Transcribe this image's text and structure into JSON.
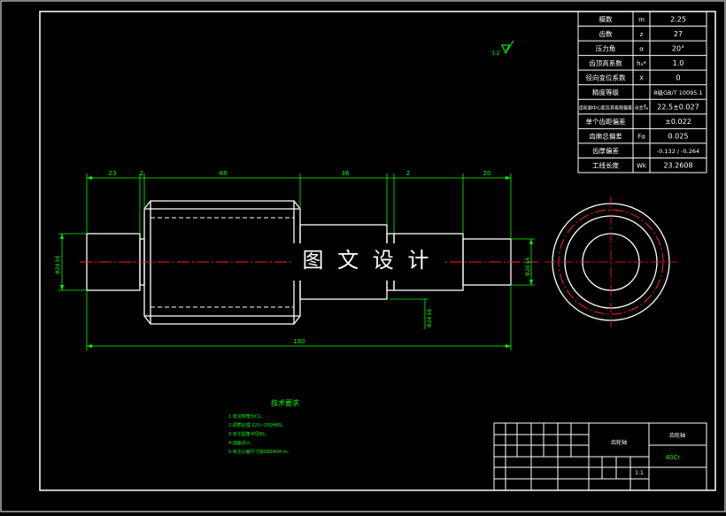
{
  "watermark": "图 文 设 计",
  "roughness": "3.2",
  "gear_table": [
    {
      "name": "模数",
      "symbol": "m",
      "value": "2.25"
    },
    {
      "name": "齿数",
      "symbol": "z",
      "value": "27"
    },
    {
      "name": "压力角",
      "symbol": "α",
      "value": "20°"
    },
    {
      "name": "齿顶高系数",
      "symbol": "hₐ*",
      "value": "1.0"
    },
    {
      "name": "径向变位系数",
      "symbol": "X",
      "value": "0"
    },
    {
      "name": "精度等级",
      "symbol": "",
      "value": "8级GB/T 10095.1"
    },
    {
      "name": "齿轮副中心距及其极限偏差",
      "symbol": "a±fₐ",
      "value": "22.5±0.027"
    },
    {
      "name": "单个齿距偏差",
      "symbol": "",
      "value": "±0.022"
    },
    {
      "name": "齿廓总偏差",
      "symbol": "Fα",
      "value": "0.025"
    },
    {
      "name": "齿厚偏差",
      "symbol": "",
      "value": "-0.132 / -0.264"
    },
    {
      "name": "工线长度",
      "symbol": "Wk",
      "value": "23.2608"
    }
  ],
  "dimensions": {
    "d1": "23",
    "d2": "2",
    "d3": "68",
    "d4": "36",
    "d5": "2",
    "d6": "20",
    "total": "180",
    "dia_left": "Φ24 k6",
    "dia_right": "Φ24 k6",
    "dia_mid": "Φ24 k6"
  },
  "tech_req": {
    "title": "技术要求",
    "items": [
      "1.未注倒角为C1。",
      "2.调质处理 220~250HBS。",
      "3.未注圆角半径R1。",
      "4.齿面淬火。",
      "5.未注公差尺寸按GB1804-m。"
    ]
  },
  "title_block": {
    "name": "齿轮轴",
    "material": "40Cr",
    "drawing_no": "齿轮轴",
    "scale": "1:1"
  }
}
